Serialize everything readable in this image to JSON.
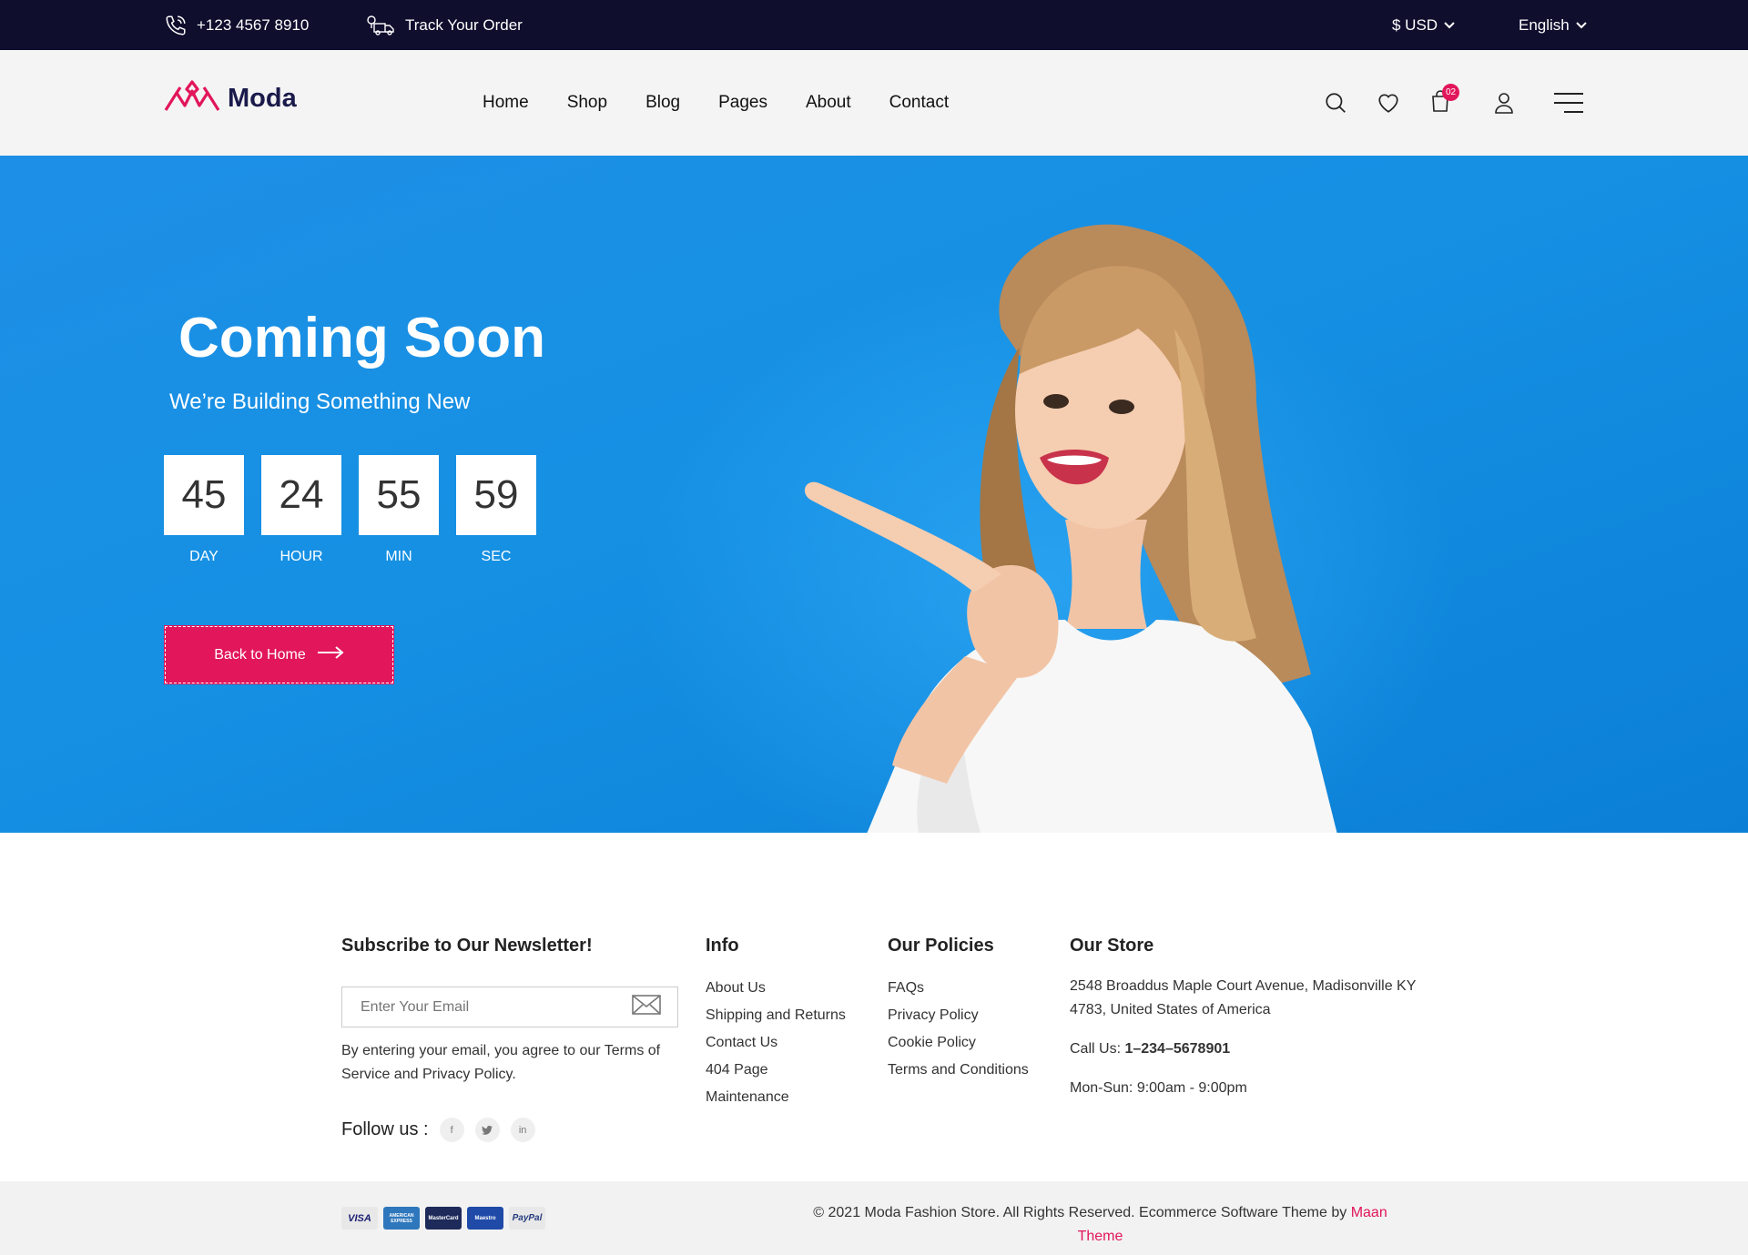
{
  "topbar": {
    "phone": "+123 4567 8910",
    "track_order": "Track Your Order",
    "currency": "$ USD",
    "language": "English"
  },
  "header": {
    "logo_text": "Moda",
    "nav": [
      "Home",
      "Shop",
      "Blog",
      "Pages",
      "About",
      "Contact"
    ],
    "cart_count": "02"
  },
  "hero": {
    "title": "Coming Soon",
    "subtitle": "We’re Building Something New",
    "countdown": [
      {
        "value": "45",
        "label": "DAY"
      },
      {
        "value": "24",
        "label": "HOUR"
      },
      {
        "value": "55",
        "label": "MIN"
      },
      {
        "value": "59",
        "label": "SEC"
      }
    ],
    "button_label": "Back to Home"
  },
  "footer": {
    "newsletter": {
      "title": "Subscribe to Our Newsletter!",
      "placeholder": "Enter Your Email",
      "terms": "By entering your email, you agree to our Terms of Service and Privacy Policy.",
      "follow_label": "Follow us :"
    },
    "info": {
      "title": "Info",
      "links": [
        "About Us",
        "Shipping and Returns",
        "Contact Us",
        "404 Page",
        "Maintenance"
      ]
    },
    "policies": {
      "title": "Our Policies",
      "links": [
        "FAQs",
        "Privacy Policy",
        "Cookie Policy",
        "Terms and Conditions"
      ]
    },
    "store": {
      "title": "Our Store",
      "address": "2548 Broaddus Maple Court Avenue, Madisonville KY 4783, United States of America",
      "call_label": "Call Us: ",
      "phone": "1–234–5678901",
      "hours": "Mon-Sun: 9:00am - 9:00pm"
    }
  },
  "bottom": {
    "payments": [
      "VISA",
      "AMERICAN EXPRESS",
      "MasterCard",
      "Maestro",
      "PayPal"
    ],
    "copyright": "© 2021 Moda Fashion Store. All Rights Reserved. Ecommerce Software Theme by ",
    "brand": "Maan Theme"
  },
  "colors": {
    "accent": "#e2165a",
    "topbar": "#0f0e2d",
    "hero_blue": "#1590e3"
  }
}
